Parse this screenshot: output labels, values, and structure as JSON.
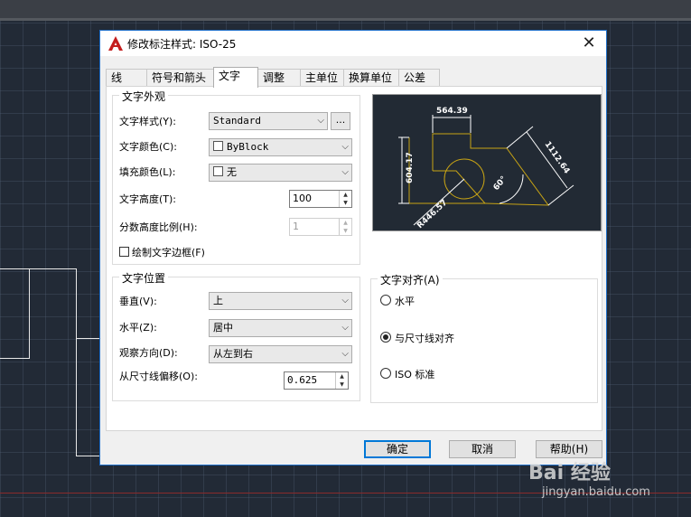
{
  "dialog": {
    "title": "修改标注样式: ISO-25",
    "close": "✕"
  },
  "tabs": [
    {
      "label": "线"
    },
    {
      "label": "符号和箭头"
    },
    {
      "label": "文字"
    },
    {
      "label": "调整"
    },
    {
      "label": "主单位"
    },
    {
      "label": "换算单位"
    },
    {
      "label": "公差"
    }
  ],
  "appearance": {
    "title": "文字外观",
    "style_label": "文字样式(Y):",
    "style_value": "Standard",
    "style_more": "...",
    "color_label": "文字颜色(C):",
    "color_value": "ByBlock",
    "fill_label": "填充颜色(L):",
    "fill_value": "无",
    "height_label": "文字高度(T):",
    "height_value": "100",
    "fraction_label": "分数高度比例(H):",
    "fraction_value": "1",
    "frame_label": "绘制文字边框(F)"
  },
  "placement": {
    "title": "文字位置",
    "vertical_label": "垂直(V):",
    "vertical_value": "上",
    "horizontal_label": "水平(Z):",
    "horizontal_value": "居中",
    "direction_label": "观察方向(D):",
    "direction_value": "从左到右",
    "offset_label": "从尺寸线偏移(O):",
    "offset_value": "0.625"
  },
  "alignment": {
    "title": "文字对齐(A)",
    "options": [
      "水平",
      "与尺寸线对齐",
      "ISO 标准"
    ],
    "selected": 1
  },
  "preview": {
    "dim_top": "564.39",
    "dim_left": "604.17",
    "dim_right": "1112.64",
    "dim_angle": "60°",
    "dim_radius": "R446.57"
  },
  "buttons": {
    "ok": "确定",
    "cancel": "取消",
    "help": "帮助(H)"
  },
  "watermark": {
    "brand": "Bai 经验",
    "url": "jingyan.baidu.com"
  },
  "colors": {
    "accent": "#0078d7",
    "preview_bg": "#222a34",
    "preview_geometry": "#c8a415"
  }
}
